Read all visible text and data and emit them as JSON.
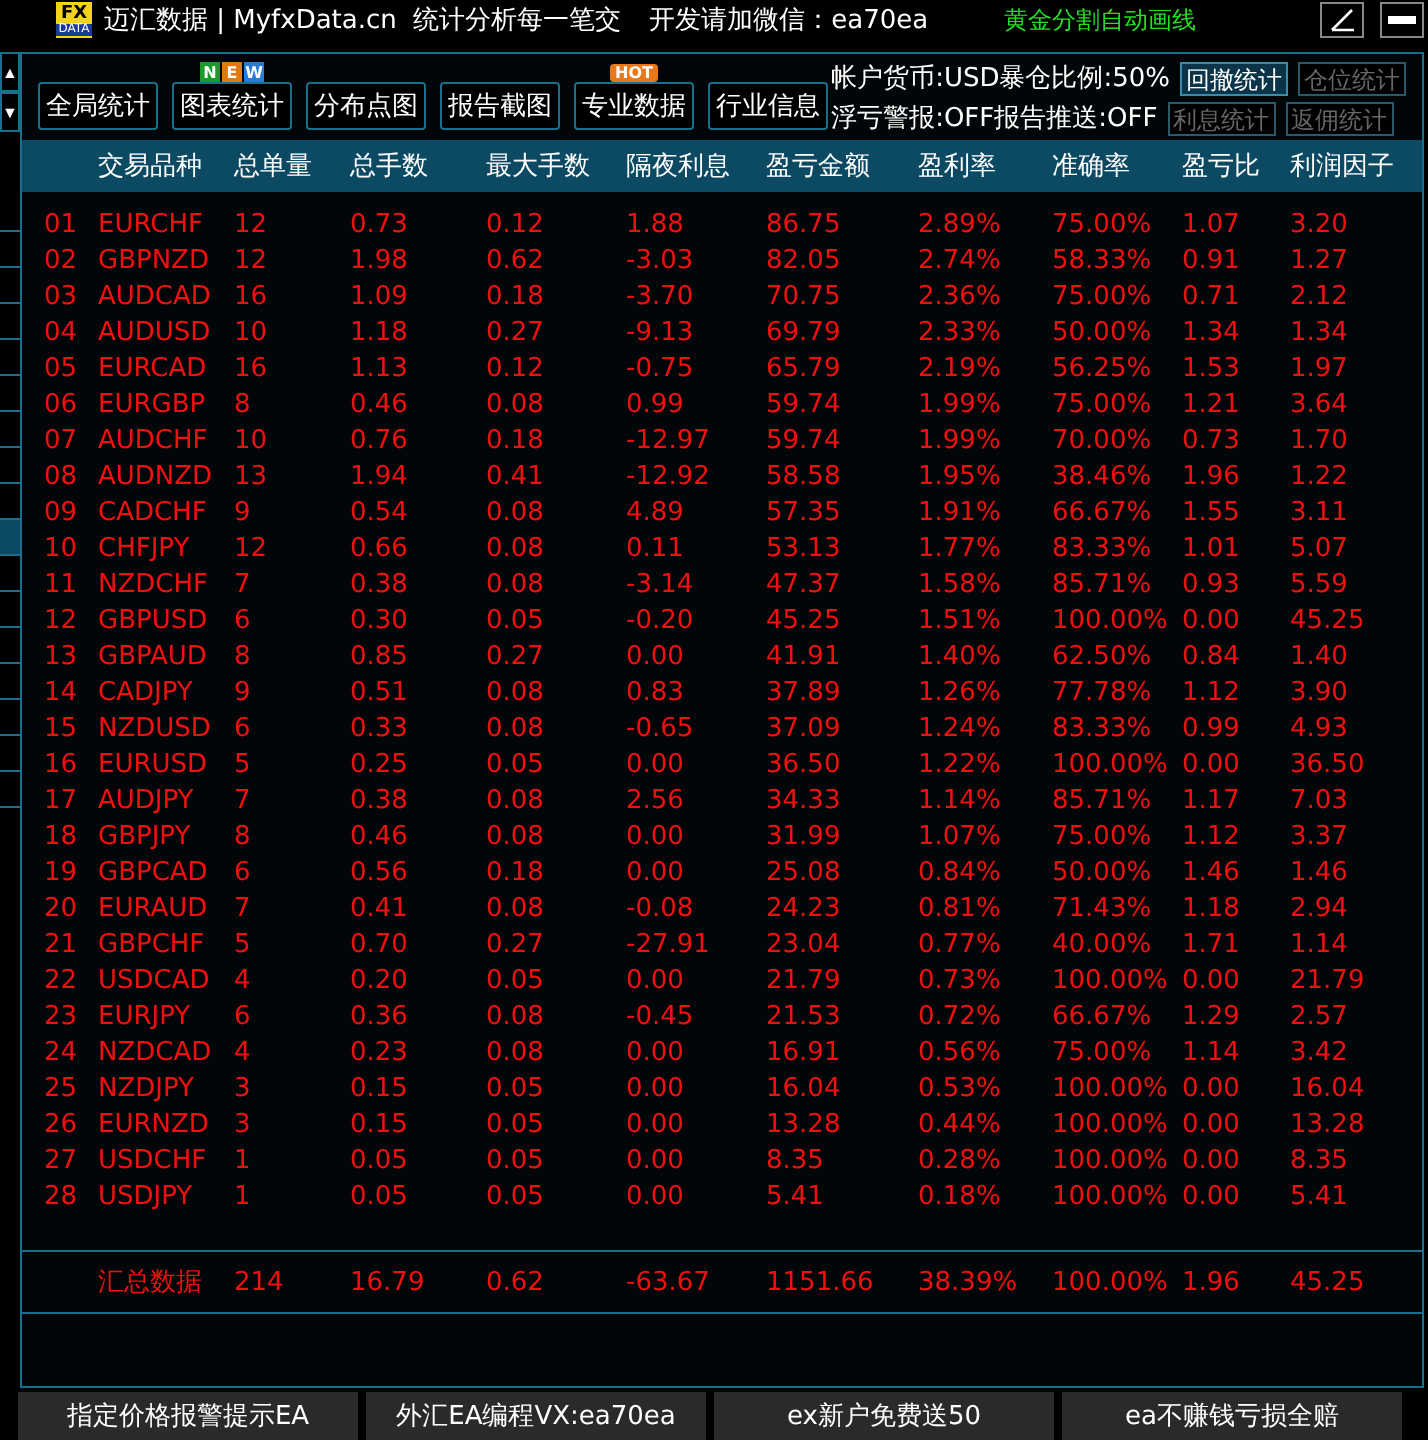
{
  "title_bar": {
    "logo_top": "FX",
    "logo_bottom": "DATA",
    "title": "迈汇数据 | MyfxData.cn  统计分析每一笔交",
    "contact": "开发请加微信：ea70ea",
    "promo": "黄金分割自动画线"
  },
  "scroll_buttons": [
    "▲",
    "▼"
  ],
  "side_tabs": [
    {
      "selected": false
    },
    {
      "selected": false
    },
    {
      "selected": false
    },
    {
      "selected": false
    },
    {
      "selected": false
    },
    {
      "selected": false
    },
    {
      "selected": false
    },
    {
      "selected": false
    },
    {
      "selected": false
    },
    {
      "selected": true
    },
    {
      "selected": false
    },
    {
      "selected": false
    },
    {
      "selected": false
    },
    {
      "selected": false
    },
    {
      "selected": false
    },
    {
      "selected": false
    },
    {
      "selected": false
    }
  ],
  "toolbar": [
    {
      "label": "全局统计"
    },
    {
      "label": "图表统计",
      "badges": [
        {
          "text": "N",
          "color": "#1a9a2a"
        },
        {
          "text": "E",
          "color": "#e07a10"
        },
        {
          "text": "W",
          "color": "#2a7ad8"
        }
      ]
    },
    {
      "label": "分布点图"
    },
    {
      "label": "报告截图"
    },
    {
      "label": "专业数据",
      "badges": [
        {
          "text": "HOT",
          "color": "#e8781a"
        }
      ]
    },
    {
      "label": "行业信息"
    }
  ],
  "account_info": [
    "帐户货币:USD暴仓比例:50%",
    "浮亏警报:OFF报告推送:OFF"
  ],
  "stat_buttons": [
    {
      "label": "回撤统计",
      "selected": true
    },
    {
      "label": "仓位统计",
      "selected": false
    },
    {
      "label": "利息统计",
      "selected": false
    },
    {
      "label": "返佣统计",
      "selected": false
    }
  ],
  "table": {
    "columns": [
      "",
      "交易品种",
      "总单量",
      "总手数",
      "最大手数",
      "隔夜利息",
      "盈亏金额",
      "盈利率",
      "准确率",
      "盈亏比",
      "利润因子"
    ],
    "rows": [
      [
        "01",
        "EURCHF",
        "12",
        "0.73",
        "0.12",
        "1.88",
        "86.75",
        "2.89%",
        "75.00%",
        "1.07",
        "3.20"
      ],
      [
        "02",
        "GBPNZD",
        "12",
        "1.98",
        "0.62",
        "-3.03",
        "82.05",
        "2.74%",
        "58.33%",
        "0.91",
        "1.27"
      ],
      [
        "03",
        "AUDCAD",
        "16",
        "1.09",
        "0.18",
        "-3.70",
        "70.75",
        "2.36%",
        "75.00%",
        "0.71",
        "2.12"
      ],
      [
        "04",
        "AUDUSD",
        "10",
        "1.18",
        "0.27",
        "-9.13",
        "69.79",
        "2.33%",
        "50.00%",
        "1.34",
        "1.34"
      ],
      [
        "05",
        "EURCAD",
        "16",
        "1.13",
        "0.12",
        "-0.75",
        "65.79",
        "2.19%",
        "56.25%",
        "1.53",
        "1.97"
      ],
      [
        "06",
        "EURGBP",
        "8",
        "0.46",
        "0.08",
        "0.99",
        "59.74",
        "1.99%",
        "75.00%",
        "1.21",
        "3.64"
      ],
      [
        "07",
        "AUDCHF",
        "10",
        "0.76",
        "0.18",
        "-12.97",
        "59.74",
        "1.99%",
        "70.00%",
        "0.73",
        "1.70"
      ],
      [
        "08",
        "AUDNZD",
        "13",
        "1.94",
        "0.41",
        "-12.92",
        "58.58",
        "1.95%",
        "38.46%",
        "1.96",
        "1.22"
      ],
      [
        "09",
        "CADCHF",
        "9",
        "0.54",
        "0.08",
        "4.89",
        "57.35",
        "1.91%",
        "66.67%",
        "1.55",
        "3.11"
      ],
      [
        "10",
        "CHFJPY",
        "12",
        "0.66",
        "0.08",
        "0.11",
        "53.13",
        "1.77%",
        "83.33%",
        "1.01",
        "5.07"
      ],
      [
        "11",
        "NZDCHF",
        "7",
        "0.38",
        "0.08",
        "-3.14",
        "47.37",
        "1.58%",
        "85.71%",
        "0.93",
        "5.59"
      ],
      [
        "12",
        "GBPUSD",
        "6",
        "0.30",
        "0.05",
        "-0.20",
        "45.25",
        "1.51%",
        "100.00%",
        "0.00",
        "45.25"
      ],
      [
        "13",
        "GBPAUD",
        "8",
        "0.85",
        "0.27",
        "0.00",
        "41.91",
        "1.40%",
        "62.50%",
        "0.84",
        "1.40"
      ],
      [
        "14",
        "CADJPY",
        "9",
        "0.51",
        "0.08",
        "0.83",
        "37.89",
        "1.26%",
        "77.78%",
        "1.12",
        "3.90"
      ],
      [
        "15",
        "NZDUSD",
        "6",
        "0.33",
        "0.08",
        "-0.65",
        "37.09",
        "1.24%",
        "83.33%",
        "0.99",
        "4.93"
      ],
      [
        "16",
        "EURUSD",
        "5",
        "0.25",
        "0.05",
        "0.00",
        "36.50",
        "1.22%",
        "100.00%",
        "0.00",
        "36.50"
      ],
      [
        "17",
        "AUDJPY",
        "7",
        "0.38",
        "0.08",
        "2.56",
        "34.33",
        "1.14%",
        "85.71%",
        "1.17",
        "7.03"
      ],
      [
        "18",
        "GBPJPY",
        "8",
        "0.46",
        "0.08",
        "0.00",
        "31.99",
        "1.07%",
        "75.00%",
        "1.12",
        "3.37"
      ],
      [
        "19",
        "GBPCAD",
        "6",
        "0.56",
        "0.18",
        "0.00",
        "25.08",
        "0.84%",
        "50.00%",
        "1.46",
        "1.46"
      ],
      [
        "20",
        "EURAUD",
        "7",
        "0.41",
        "0.08",
        "-0.08",
        "24.23",
        "0.81%",
        "71.43%",
        "1.18",
        "2.94"
      ],
      [
        "21",
        "GBPCHF",
        "5",
        "0.70",
        "0.27",
        "-27.91",
        "23.04",
        "0.77%",
        "40.00%",
        "1.71",
        "1.14"
      ],
      [
        "22",
        "USDCAD",
        "4",
        "0.20",
        "0.05",
        "0.00",
        "21.79",
        "0.73%",
        "100.00%",
        "0.00",
        "21.79"
      ],
      [
        "23",
        "EURJPY",
        "6",
        "0.36",
        "0.08",
        "-0.45",
        "21.53",
        "0.72%",
        "66.67%",
        "1.29",
        "2.57"
      ],
      [
        "24",
        "NZDCAD",
        "4",
        "0.23",
        "0.08",
        "0.00",
        "16.91",
        "0.56%",
        "75.00%",
        "1.14",
        "3.42"
      ],
      [
        "25",
        "NZDJPY",
        "3",
        "0.15",
        "0.05",
        "0.00",
        "16.04",
        "0.53%",
        "100.00%",
        "0.00",
        "16.04"
      ],
      [
        "26",
        "EURNZD",
        "3",
        "0.15",
        "0.05",
        "0.00",
        "13.28",
        "0.44%",
        "100.00%",
        "0.00",
        "13.28"
      ],
      [
        "27",
        "USDCHF",
        "1",
        "0.05",
        "0.05",
        "0.00",
        "8.35",
        "0.28%",
        "100.00%",
        "0.00",
        "8.35"
      ],
      [
        "28",
        "USDJPY",
        "1",
        "0.05",
        "0.05",
        "0.00",
        "5.41",
        "0.18%",
        "100.00%",
        "0.00",
        "5.41"
      ]
    ],
    "summary": [
      "汇总数据",
      "214",
      "16.79",
      "0.62",
      "-63.67",
      "1151.66",
      "38.39%",
      "100.00%",
      "1.96",
      "45.25"
    ]
  },
  "footer_buttons": [
    "指定价格报警提示EA",
    "外汇EA编程VX:ea70ea",
    "ex新户免费送50",
    "ea不赚钱亏损全赔"
  ]
}
